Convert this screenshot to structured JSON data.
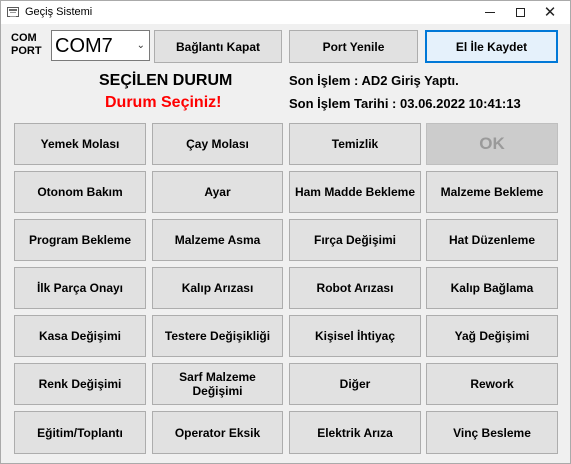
{
  "window": {
    "title": "Geçiş Sistemi"
  },
  "port": {
    "label": "COM PORT",
    "selected": "COM7"
  },
  "toolbar": {
    "connect_label": "Bağlantı Kapat",
    "refresh_label": "Port Yenile",
    "manual_label": "El İle Kaydet"
  },
  "status": {
    "heading": "SEÇİLEN DURUM",
    "value": "Durum Seçiniz!",
    "last_op": "Son İşlem : AD2 Giriş Yaptı.",
    "last_date": "Son İşlem Tarihi : 03.06.2022 10:41:13"
  },
  "colors": {
    "status_value": "#ff0000",
    "default_button_border": "#0078d7"
  },
  "grid": {
    "ok_label": "OK",
    "items": [
      "Yemek Molası",
      "Çay Molası",
      "Temizlik",
      "Otonom Bakım",
      "Ayar",
      "Ham Madde Bekleme",
      "Malzeme Bekleme",
      "Program Bekleme",
      "Malzeme Asma",
      "Fırça Değişimi",
      "Hat Düzenleme",
      "İlk Parça Onayı",
      "Kalıp Arızası",
      "Robot Arızası",
      "Kalıp Bağlama",
      "Kasa Değişimi",
      "Testere Değişikliği",
      "Kişisel İhtiyaç",
      "Yağ Değişimi",
      "Renk Değişimi",
      "Sarf Malzeme Değişimi",
      "Diğer",
      "Rework",
      "Eğitim/Toplantı",
      "Operator Eksik",
      "Elektrik Arıza",
      "Vinç Besleme"
    ]
  }
}
